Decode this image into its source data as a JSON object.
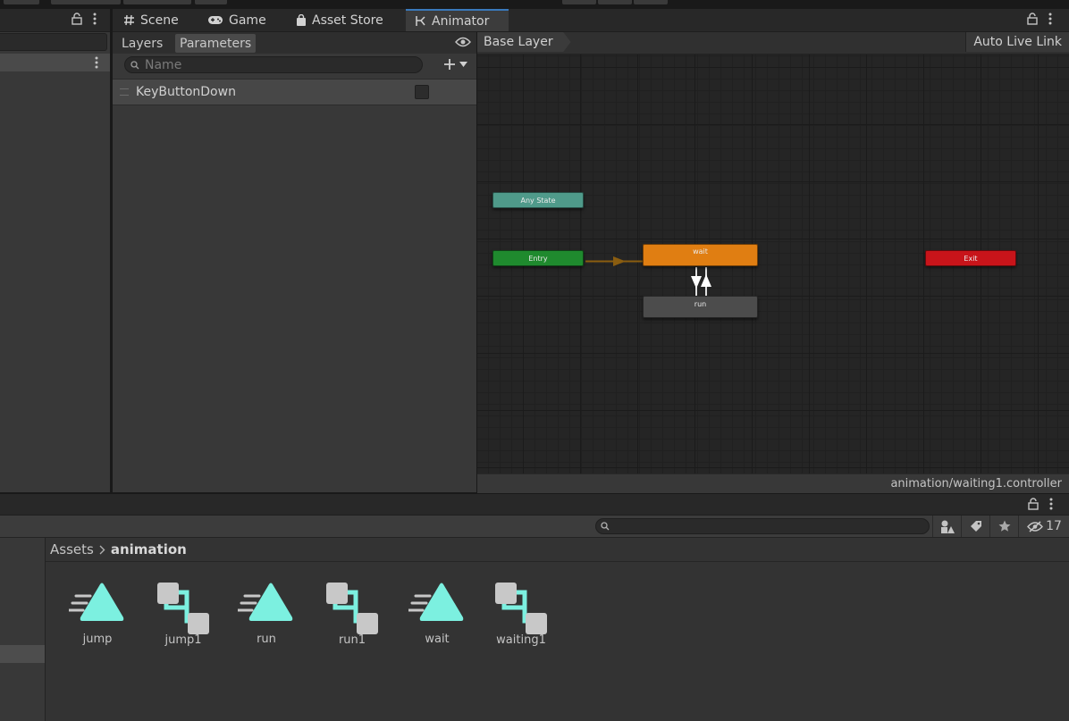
{
  "tabs": [
    {
      "label": "Scene",
      "icon": "hash-icon"
    },
    {
      "label": "Game",
      "icon": "gamepad-icon"
    },
    {
      "label": "Asset Store",
      "icon": "shopping-bag-icon"
    },
    {
      "label": "Animator",
      "icon": "animator-icon",
      "active": true
    }
  ],
  "animator": {
    "subtabs": [
      "Layers",
      "Parameters"
    ],
    "active_subtab": "Parameters",
    "search_placeholder": "Name",
    "parameters": [
      {
        "name": "KeyButtonDown",
        "type": "bool",
        "value": false
      }
    ],
    "breadcrumb": "Base Layer",
    "auto_live_link": "Auto Live Link",
    "controller_path": "animation/waiting1.controller",
    "states": {
      "any_state": "Any State",
      "entry": "Entry",
      "wait": "wait",
      "run": "run",
      "exit": "Exit"
    }
  },
  "project": {
    "breadcrumb": [
      "Assets",
      "animation"
    ],
    "hidden_count": "17",
    "assets": [
      {
        "name": "jump",
        "kind": "animation-clip"
      },
      {
        "name": "jump1",
        "kind": "animator-controller"
      },
      {
        "name": "run",
        "kind": "animation-clip"
      },
      {
        "name": "run1",
        "kind": "animator-controller"
      },
      {
        "name": "wait",
        "kind": "animation-clip"
      },
      {
        "name": "waiting1",
        "kind": "animator-controller"
      }
    ]
  },
  "colors": {
    "accent": "#3a79bb",
    "any_state": "#4f9a8a",
    "entry": "#1f8a2e",
    "default_state": "#e07e12",
    "state": "#4c4c4c",
    "exit": "#c8141a",
    "asset_icon": "#7cf0e0"
  }
}
